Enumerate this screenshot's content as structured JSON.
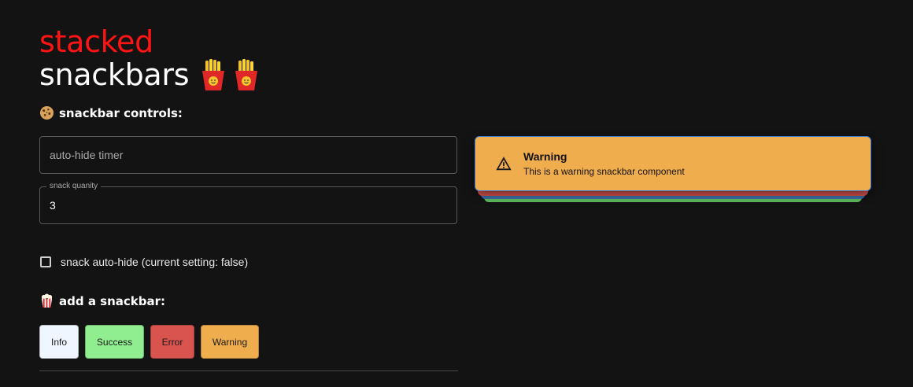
{
  "title": {
    "line1": "stacked",
    "line2": "snackbars",
    "icons": [
      "fries-icon",
      "fries-icon"
    ]
  },
  "controls": {
    "heading": "snackbar controls:",
    "heading_icon": "cookie-icon",
    "timer_field": {
      "placeholder": "auto-hide timer",
      "value": ""
    },
    "quantity_field": {
      "label": "snack quanity",
      "value": "3"
    },
    "auto_hide": {
      "label": "snack auto-hide (current setting: false)",
      "checked": false
    }
  },
  "add": {
    "heading": "add a snackbar:",
    "heading_icon": "popcorn-icon",
    "buttons": [
      {
        "label": "Info",
        "color": "#f0f6ff"
      },
      {
        "label": "Success",
        "color": "#90ee90"
      },
      {
        "label": "Error",
        "color": "#d9534f"
      },
      {
        "label": "Warning",
        "color": "#f0ad4e"
      }
    ]
  },
  "snackbar": {
    "title": "Warning",
    "message": "This is a warning snackbar component",
    "icon": "warning-icon",
    "color": "#f0ad4e",
    "stack_colors": [
      "#5cb85c",
      "#3b6ea5",
      "#d9534f"
    ]
  }
}
